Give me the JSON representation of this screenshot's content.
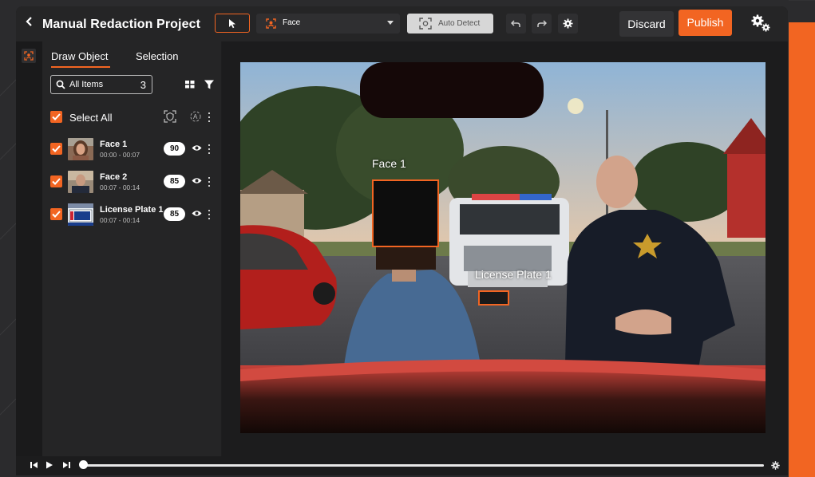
{
  "header": {
    "title": "Manual Redaction Project",
    "object_type": "Face",
    "auto_detect_label": "Auto Detect",
    "discard_label": "Discard",
    "publish_label": "Publish"
  },
  "panel": {
    "tabs": [
      {
        "label": "Draw Object",
        "active": true
      },
      {
        "label": "Selection",
        "active": false
      }
    ],
    "search": {
      "placeholder": "All Items",
      "count": "3"
    },
    "select_all_label": "Select All",
    "items": [
      {
        "title": "Face 1",
        "time": "00:00 - 00:07",
        "score": "90",
        "checked": true
      },
      {
        "title": "Face 2",
        "time": "00:07 - 00:14",
        "score": "85",
        "checked": true
      },
      {
        "title": "License Plate 1",
        "time": "00:07 - 00:14",
        "score": "85",
        "checked": true
      }
    ]
  },
  "canvas": {
    "redactions": [
      {
        "label": "Face 1"
      },
      {
        "label": "License Plate 1"
      }
    ]
  },
  "colors": {
    "accent": "#f26522",
    "panel_bg": "#252526",
    "app_bg": "#1e1e1f"
  },
  "icons": [
    "back-icon",
    "pointer-icon",
    "face-detect-icon",
    "auto-detect-icon",
    "undo-icon",
    "redo-icon",
    "gear-icon",
    "settings-gears-icon",
    "search-icon",
    "grid-icon",
    "filter-icon",
    "eye-icon",
    "play-icon",
    "rewind-icon",
    "forward-icon"
  ]
}
